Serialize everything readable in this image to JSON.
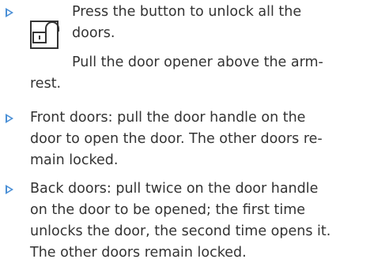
{
  "item1": {
    "lines": [
      "Press the button to unlock all the",
      "doors."
    ],
    "sub_lines": [
      "Pull the door opener above the arm-",
      "rest."
    ]
  },
  "item2": {
    "lines": [
      "Front doors: pull the door handle on the",
      "door to open the door. The other doors re-",
      "main locked."
    ]
  },
  "item3": {
    "lines": [
      "Back doors: pull twice on the door handle",
      "on the door to be opened; the first time",
      "unlocks the door, the second time opens it.",
      "The other doors remain locked."
    ]
  },
  "colors": {
    "bullet": "#4a8fd6",
    "text": "#333333"
  },
  "icons": {
    "bullet": "triangle-bullet-icon",
    "unlock": "unlock-icon"
  }
}
